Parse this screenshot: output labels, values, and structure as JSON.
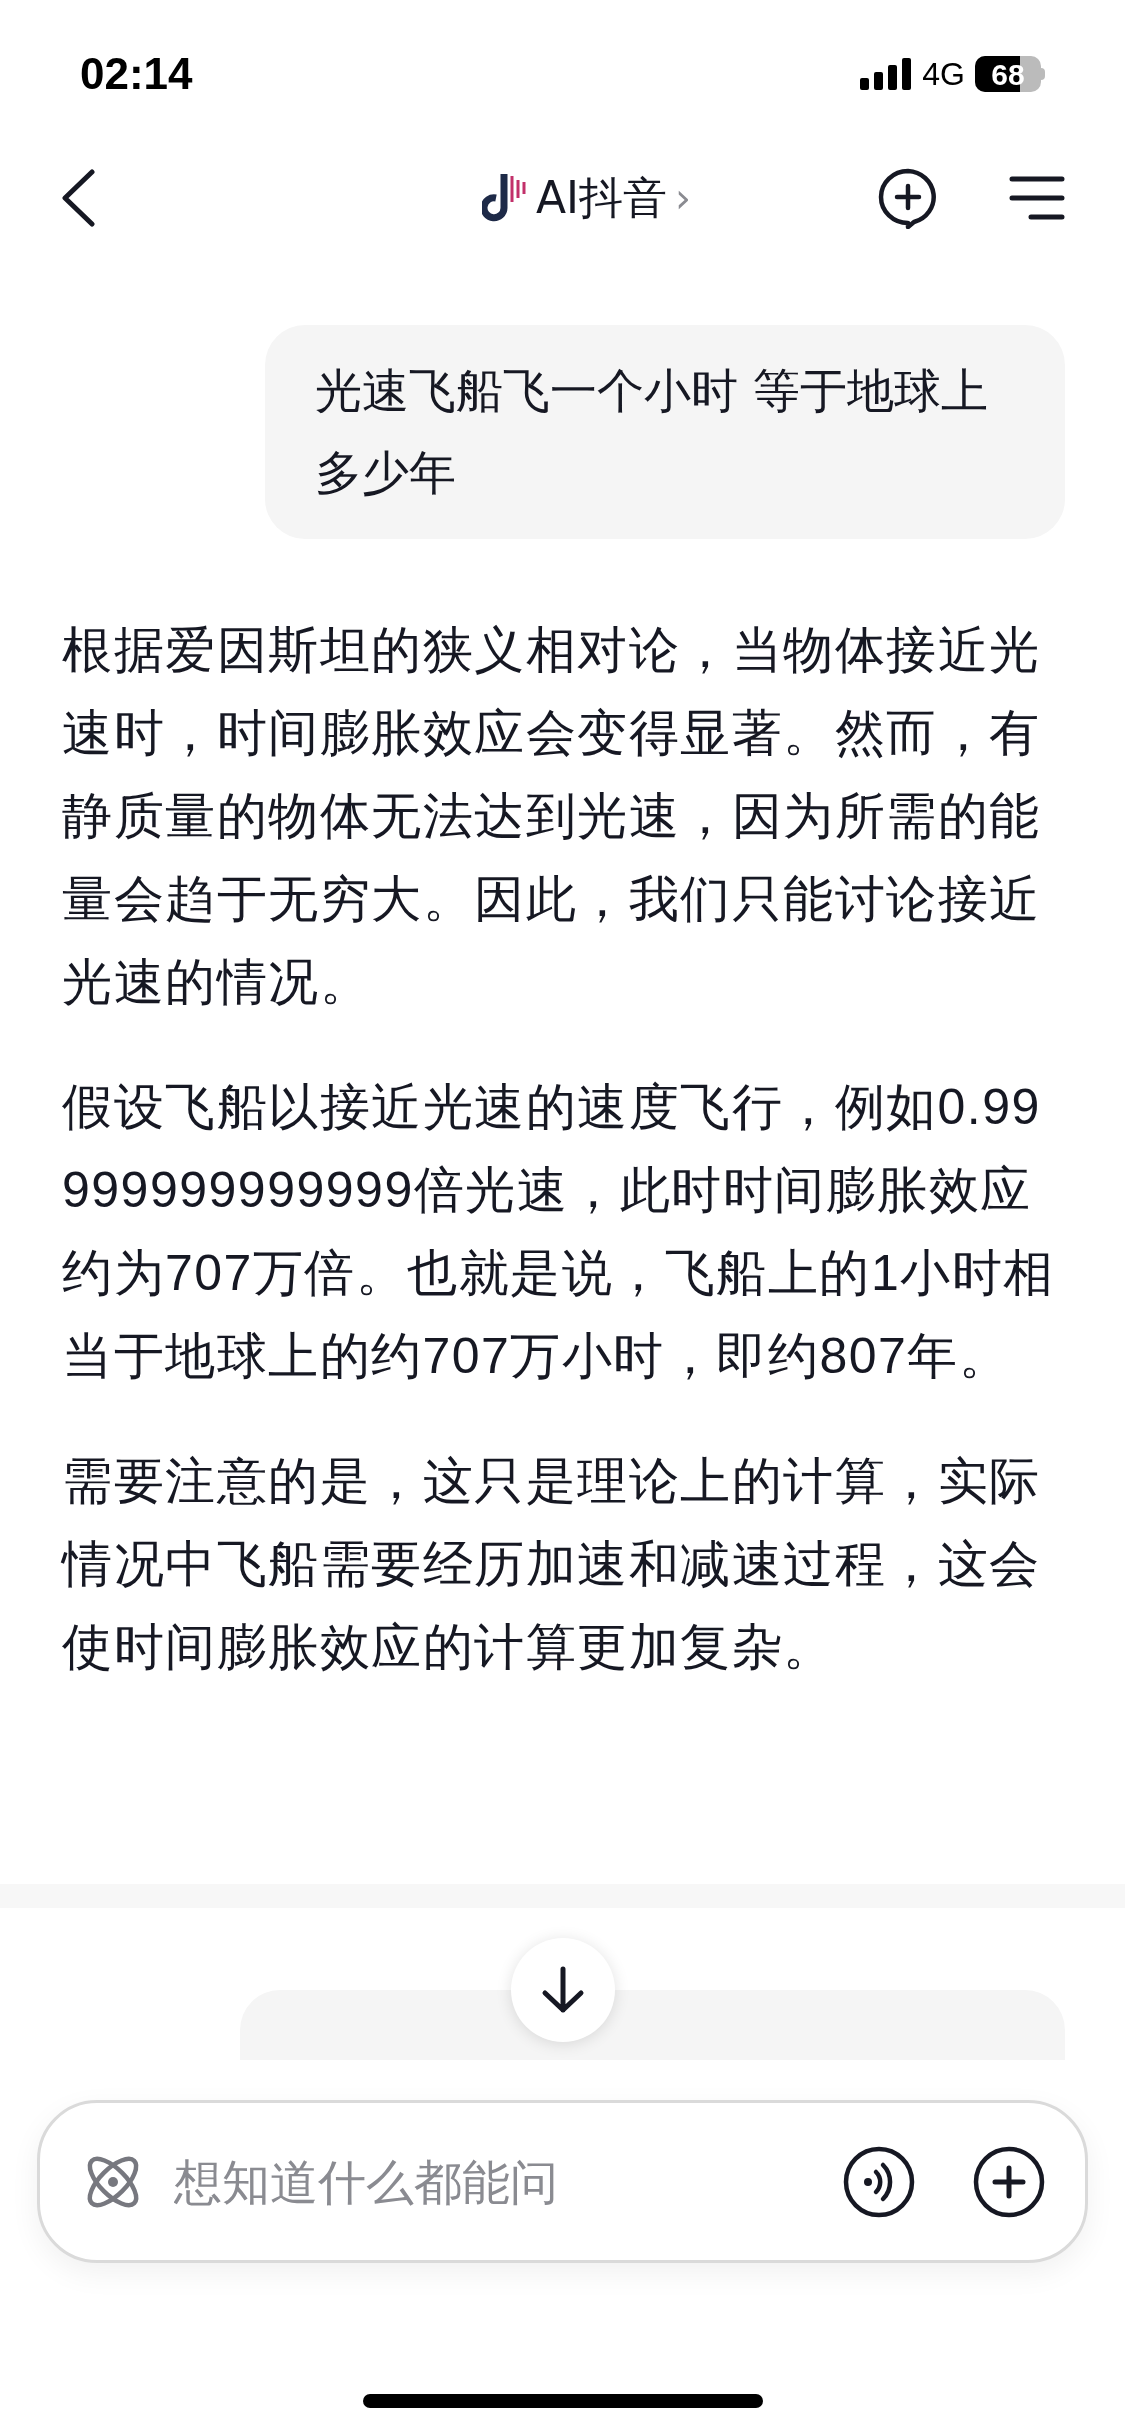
{
  "status_bar": {
    "time": "02:14",
    "network": "4G",
    "battery": "68"
  },
  "nav": {
    "title": "AI抖音",
    "chevron": "›"
  },
  "messages": [
    {
      "kind": "user",
      "text": "光速飞船飞一个小时 等于地球上多少年"
    },
    {
      "kind": "assistant",
      "paragraphs": [
        "根据爱因斯坦的狭义相对论，当物体接近光速时，时间膨胀效应会变得显著。然而，有静质量的物体无法达到光速，因为所需的能量会趋于无穷大。因此，我们只能讨论接近光速的情况。",
        "假设飞船以接近光速的速度飞行，例如0.99999999999999倍光速，此时时间膨胀效应约为707万倍。也就是说，飞船上的1小时相当于地球上的约707万小时，即约807年。",
        "需要注意的是，这只是理论上的计算，实际情况中飞船需要经历加速和减速过程，这会使时间膨胀效应的计算更加复杂。"
      ]
    },
    {
      "kind": "user_cut"
    }
  ],
  "composer": {
    "placeholder": "想知道什么都能问"
  }
}
